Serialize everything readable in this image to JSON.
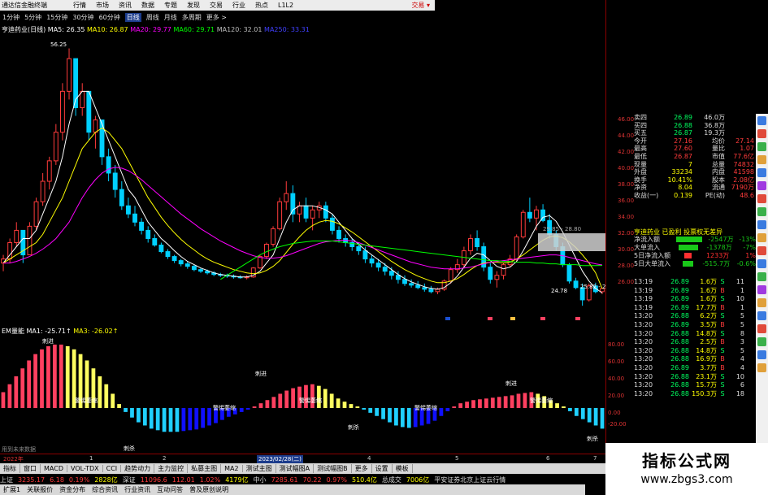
{
  "window": {
    "title": "通达信金融终端",
    "trade": "交易 ▾"
  },
  "menu": [
    "行情",
    "市场",
    "资讯",
    "数据",
    "专题",
    "发现",
    "交易",
    "行业",
    "热点",
    "L1L2"
  ],
  "timeframes": [
    "1分钟",
    "5分钟",
    "15分钟",
    "30分钟",
    "60分钟",
    "日线",
    "周线",
    "月线",
    "多周期",
    "更多 >"
  ],
  "active_tf": "日线",
  "main_legend": {
    "name": "亨迪药业(日线)",
    "ma5": "MA5: 26.35",
    "ma10": "MA10: 26.87",
    "ma20": "MA20: 29.77",
    "ma60": "MA60: 29.71",
    "ma120": "MA120: 32.01",
    "ma250": "MA250: 33.31"
  },
  "price_axis": [
    "46.00",
    "44.00",
    "42.00",
    "40.00",
    "38.00",
    "36.00",
    "34.00",
    "32.00",
    "30.00",
    "28.00",
    "26.00"
  ],
  "ind_axis": [
    "80.00",
    "60.00",
    "40.00",
    "20.00",
    "0.00",
    "-20.00"
  ],
  "price_labels": {
    "high": "56.25",
    "low": "24.78",
    "zone": "29.85 - 28.80",
    "recent": "25.82 - 26"
  },
  "ind_legend": {
    "name": "EM量能",
    "ma1": "MA1: -25.71↑",
    "ma3": "MA3: -26.02↑"
  },
  "ind_labels": {
    "strong": "刺进",
    "weak": "刺杀",
    "shrink": "警惕萎缩"
  },
  "dates": [
    "2022年",
    "1",
    "2",
    "2023/02/28(二)",
    "4",
    "5",
    "6",
    "7"
  ],
  "corner_text": "用到未来数据",
  "tabs": [
    "指标",
    "窗口",
    "MACD",
    "VOL-TDX",
    "CCI",
    "趋势动力",
    "主力监控",
    "私募主图",
    "MA2",
    "测试主图",
    "测试幅图A",
    "测试幅图B",
    "更多",
    "设置",
    "模板"
  ],
  "idx": [
    {
      "n": "上证",
      "v": "3235.17",
      "c": "6.18",
      "p": "0.19%",
      "a": "2828亿"
    },
    {
      "n": "深证",
      "v": "11096.6",
      "c": "112.01",
      "p": "1.02%",
      "a": "4179亿"
    },
    {
      "n": "中小",
      "v": "7285.61",
      "c": "70.22",
      "p": "0.97%",
      "a": "510.4亿"
    }
  ],
  "idx_extra": {
    "a": "总成交",
    "b": "7006亿",
    "c": "平安证券北京上证云行情"
  },
  "sub_status": [
    "扩展1",
    "关联报价",
    "资金分布",
    "综合资讯",
    "行业资讯",
    "互动问答",
    "普及原创说明"
  ],
  "quote_rows": [
    {
      "l": "卖四",
      "p": "26.89",
      "v": "46.0万",
      "x": ""
    },
    {
      "l": "买四",
      "p": "26.88",
      "v": "36.8万",
      "x": ""
    },
    {
      "l": "买五",
      "p": "26.87",
      "v": "19.3万",
      "x": ""
    },
    {
      "l": "今开",
      "p": "27.16",
      "v": "均价",
      "x": "27.14"
    },
    {
      "l": "最高",
      "p": "27.60",
      "v": "量比",
      "x": "1.07"
    },
    {
      "l": "最低",
      "p": "26.87",
      "v": "市值",
      "x": "77.6亿"
    },
    {
      "l": "现量",
      "p": "7",
      "v": "总量",
      "x": "74832"
    },
    {
      "l": "外盘",
      "p": "33234",
      "v": "内盘",
      "x": "41598"
    },
    {
      "l": "换手",
      "p": "10.41%",
      "v": "股本",
      "x": "2.08亿"
    },
    {
      "l": "净资",
      "p": "8.04",
      "v": "流通",
      "x": "7190万"
    },
    {
      "l": "收益(一)",
      "p": "0.139",
      "v": "PE(动)",
      "x": "48.6"
    }
  ],
  "stock_name": "亨迪药业 已盈利 投票权无差异",
  "flow": [
    {
      "l": "净流入额",
      "v": "-2547万",
      "v2": "-13%",
      "c": "#19c819",
      "w": 40
    },
    {
      "l": "大单流入",
      "v": "-1378万",
      "v2": "-7%",
      "c": "#19c819",
      "w": 28
    },
    {
      "l": "5日净流入额",
      "v": "1233万",
      "v2": "1%",
      "c": "#ff3030",
      "w": 10
    },
    {
      "l": "5日大单流入",
      "v": "-515.7万",
      "v2": "-0.6%",
      "c": "#19c819",
      "w": 14
    }
  ],
  "ticks": [
    {
      "t": "13:19",
      "p": "26.89",
      "v": "1.6万",
      "d": "S",
      "n": "11"
    },
    {
      "t": "13:19",
      "p": "26.89",
      "v": "1.6万",
      "d": "B",
      "n": "1"
    },
    {
      "t": "13:19",
      "p": "26.89",
      "v": "1.6万",
      "d": "S",
      "n": "10"
    },
    {
      "t": "13:19",
      "p": "26.89",
      "v": "17.7万",
      "d": "B",
      "n": "1"
    },
    {
      "t": "13:20",
      "p": "26.88",
      "v": "6.2万",
      "d": "S",
      "n": "5"
    },
    {
      "t": "13:20",
      "p": "26.89",
      "v": "3.5万",
      "d": "B",
      "n": "5"
    },
    {
      "t": "13:20",
      "p": "26.88",
      "v": "14.8万",
      "d": "S",
      "n": "8"
    },
    {
      "t": "13:20",
      "p": "26.88",
      "v": "2.5万",
      "d": "B",
      "n": "3"
    },
    {
      "t": "13:20",
      "p": "26.88",
      "v": "14.8万",
      "d": "S",
      "n": "5"
    },
    {
      "t": "13:20",
      "p": "26.88",
      "v": "16.9万",
      "d": "B",
      "n": "4"
    },
    {
      "t": "13:20",
      "p": "26.89",
      "v": "3.7万",
      "d": "B",
      "n": "4"
    },
    {
      "t": "13:20",
      "p": "26.88",
      "v": "23.1万",
      "d": "S",
      "n": "10"
    },
    {
      "t": "13:20",
      "p": "26.88",
      "v": "15.7万",
      "d": "S",
      "n": "6"
    },
    {
      "t": "13:20",
      "p": "26.88",
      "v": "150.3万",
      "d": "S",
      "n": "18"
    }
  ],
  "watermark": {
    "title": "指标公式网",
    "url": "www.zbgs3.com"
  },
  "colors": {
    "up": "#ff3b3b",
    "down": "#00d0ff",
    "ma5": "#ffffff",
    "ma10": "#ffff00",
    "ma20": "#ff00ff",
    "ma60": "#00ff00",
    "ma120": "#b0b0b0",
    "ma250": "#4040ff",
    "bar_red": "#ff4060",
    "bar_yel": "#ffff60",
    "bar_cyan": "#20d0ff",
    "bar_blue": "#1010ff"
  },
  "chart_data": {
    "type": "candlestick",
    "candles": [
      [
        30,
        31,
        29,
        30.5
      ],
      [
        30.5,
        33,
        30,
        32.5
      ],
      [
        32.5,
        35,
        32,
        34
      ],
      [
        34,
        33,
        30,
        31
      ],
      [
        31,
        35,
        31,
        34.5
      ],
      [
        34.5,
        38,
        34,
        37.5
      ],
      [
        37.5,
        41,
        37,
        40
      ],
      [
        40,
        43,
        39,
        42.5
      ],
      [
        42.5,
        47,
        42,
        46
      ],
      [
        46,
        52,
        45,
        51
      ],
      [
        51,
        56.25,
        50,
        55
      ],
      [
        55,
        54,
        48,
        49
      ],
      [
        49,
        52,
        48,
        51
      ],
      [
        51,
        50,
        45,
        46
      ],
      [
        46,
        48,
        44,
        47.5
      ],
      [
        47.5,
        46,
        42,
        43
      ],
      [
        43,
        44,
        40,
        41
      ],
      [
        41,
        42,
        38,
        39
      ],
      [
        39,
        40,
        36.5,
        37
      ],
      [
        37,
        38,
        35.5,
        36
      ],
      [
        36,
        37,
        34.5,
        35
      ],
      [
        35,
        35.5,
        33.5,
        34
      ],
      [
        34,
        34.5,
        32.5,
        33
      ],
      [
        33,
        33.5,
        32,
        32.2
      ],
      [
        32.2,
        32.5,
        31.2,
        31.4
      ],
      [
        31.4,
        31.7,
        30.5,
        30.8
      ],
      [
        30.8,
        31,
        30,
        30.3
      ],
      [
        30.3,
        30.5,
        29.6,
        29.9
      ],
      [
        29.9,
        30.2,
        29.3,
        29.6
      ],
      [
        29.6,
        29.8,
        29,
        29.2
      ],
      [
        29.2,
        29.4,
        28.8,
        29
      ],
      [
        29,
        29.2,
        28.6,
        28.8
      ],
      [
        28.8,
        29,
        28.4,
        28.6
      ],
      [
        28.6,
        28.8,
        28.3,
        28.5
      ],
      [
        28.5,
        28.7,
        28.2,
        28.4
      ],
      [
        28.4,
        28.6,
        28.1,
        28.3
      ],
      [
        28.3,
        28.5,
        28.1,
        28.2
      ],
      [
        28.2,
        28.5,
        28,
        28.3
      ],
      [
        28.3,
        29.5,
        28.2,
        29.4
      ],
      [
        29.4,
        31,
        29.3,
        30.8
      ],
      [
        30.8,
        32.5,
        30.5,
        32.3
      ],
      [
        32.3,
        34.5,
        32,
        34.2
      ],
      [
        34.2,
        38,
        34,
        37.5
      ],
      [
        37.5,
        40,
        36.5,
        38.5
      ],
      [
        38.5,
        39.5,
        35,
        36
      ],
      [
        36,
        37.5,
        35,
        37
      ],
      [
        37,
        38,
        35,
        35.5
      ],
      [
        35.5,
        37,
        34,
        36.5
      ],
      [
        36.5,
        37.5,
        35.5,
        37
      ],
      [
        37,
        37.5,
        35,
        35.5
      ],
      [
        35.5,
        36,
        33.5,
        34
      ],
      [
        34,
        34.5,
        32.5,
        33
      ],
      [
        33,
        33.5,
        32,
        32.5
      ],
      [
        32.5,
        33,
        31.5,
        32
      ],
      [
        32,
        32.5,
        31,
        31.5
      ],
      [
        31.5,
        32,
        30,
        30.5
      ],
      [
        30.5,
        31,
        29.5,
        30
      ],
      [
        30,
        30.5,
        29,
        29.5
      ],
      [
        29.5,
        30,
        28.5,
        29
      ],
      [
        29,
        29.5,
        28,
        28.5
      ],
      [
        28.5,
        29,
        27.5,
        28
      ],
      [
        28,
        28.5,
        27.2,
        27.5
      ],
      [
        27.5,
        28,
        27,
        27.3
      ],
      [
        27.3,
        27.8,
        26.8,
        27
      ],
      [
        27,
        27.5,
        26.5,
        26.8
      ],
      [
        26.8,
        27.2,
        26.3,
        26.5
      ],
      [
        26.5,
        27,
        26.2,
        26.8
      ],
      [
        26.8,
        28,
        26.6,
        27.8
      ],
      [
        27.8,
        29.5,
        27.5,
        29.2
      ],
      [
        29.2,
        30.5,
        28.8,
        29.8
      ],
      [
        29.8,
        32,
        29.5,
        31.5
      ],
      [
        31.5,
        33.5,
        31,
        33
      ],
      [
        33,
        34,
        31.5,
        32
      ],
      [
        32,
        32.5,
        29,
        29.5
      ],
      [
        29.5,
        30,
        27.5,
        28
      ],
      [
        28,
        29,
        27,
        28.5
      ],
      [
        28.5,
        30,
        28,
        29.8
      ],
      [
        29.8,
        31,
        29.5,
        30.5
      ],
      [
        30.5,
        33.5,
        30.2,
        33.2
      ],
      [
        33.2,
        36.5,
        33,
        36.2
      ],
      [
        36.2,
        38,
        35,
        35.5
      ],
      [
        35.5,
        37,
        34,
        36.5
      ],
      [
        36.5,
        37.2,
        35,
        35.2
      ],
      [
        35.2,
        36,
        33,
        33.5
      ],
      [
        33.5,
        34,
        31.5,
        32
      ],
      [
        32,
        32.5,
        29.5,
        29.8
      ],
      [
        29.8,
        30,
        27.5,
        27.8
      ],
      [
        27.8,
        28.2,
        26.8,
        27
      ],
      [
        27,
        27.5,
        24.78,
        25.5
      ],
      [
        25.5,
        27.5,
        25.3,
        27.2
      ],
      [
        27.2,
        27.6,
        26.3,
        26.5
      ],
      [
        26.5,
        27,
        26.2,
        26.89
      ]
    ],
    "ma5": [
      30,
      31,
      32,
      33,
      33,
      34,
      36,
      38,
      40,
      43,
      47,
      50,
      51,
      51,
      49,
      47,
      45,
      43,
      41,
      39,
      38,
      36.5,
      35,
      34,
      33,
      32.3,
      31.5,
      30.8,
      30.2,
      29.8,
      29.4,
      29.1,
      28.8,
      28.6,
      28.5,
      28.4,
      28.3,
      28.3,
      28.5,
      29,
      30,
      31,
      33,
      35,
      36.5,
      37,
      37,
      37,
      36.8,
      36.5,
      36,
      35,
      34,
      33,
      32.3,
      31.6,
      31,
      30.4,
      29.8,
      29.2,
      28.6,
      28.1,
      27.7,
      27.4,
      27.1,
      26.9,
      26.8,
      27,
      27.6,
      28.4,
      29.5,
      30.6,
      31.2,
      31,
      30.3,
      29.6,
      29.3,
      29.5,
      30.2,
      31.5,
      33,
      34.5,
      35.6,
      35.8,
      35.1,
      33.8,
      32.2,
      30.6,
      29,
      27.8,
      26.9,
      26.35
    ],
    "ma10": [
      30,
      30.5,
      31,
      31.5,
      32,
      32.5,
      33.5,
      35,
      36.5,
      38,
      40,
      42,
      44,
      45,
      46,
      46.5,
      46,
      45,
      44,
      42.5,
      41,
      39.5,
      38,
      36.8,
      35.6,
      34.6,
      33.7,
      32.9,
      32.2,
      31.6,
      31,
      30.5,
      30.1,
      29.8,
      29.5,
      29.2,
      29,
      28.8,
      28.7,
      28.8,
      29.1,
      29.6,
      30.3,
      31.3,
      32.3,
      33.2,
      34,
      34.6,
      35,
      35.2,
      35.1,
      34.8,
      34.3,
      33.8,
      33.2,
      32.6,
      32,
      31.4,
      30.8,
      30.2,
      29.7,
      29.2,
      28.8,
      28.4,
      28.1,
      27.8,
      27.6,
      27.6,
      27.8,
      28.1,
      28.6,
      29.2,
      29.7,
      30,
      30.1,
      30.1,
      30,
      30.1,
      30.5,
      31,
      31.6,
      32.2,
      32.8,
      33.2,
      33.3,
      33.1,
      32.6,
      31.9,
      31,
      30,
      28.8,
      26.87
    ],
    "ma20": [
      30,
      30,
      30.2,
      30.5,
      30.8,
      31.2,
      31.7,
      32.3,
      33,
      34,
      35,
      36.5,
      38,
      39.2,
      40.2,
      41,
      41.5,
      41.7,
      41.6,
      41.3,
      40.8,
      40.2,
      39.5,
      38.8,
      38.1,
      37.4,
      36.7,
      36,
      35.4,
      34.8,
      34.2,
      33.7,
      33.2,
      32.7,
      32.3,
      31.9,
      31.5,
      31.2,
      30.9,
      30.7,
      30.6,
      30.6,
      30.7,
      30.9,
      31.2,
      31.5,
      31.8,
      32.1,
      32.4,
      32.6,
      32.7,
      32.8,
      32.8,
      32.7,
      32.5,
      32.2,
      31.9,
      31.6,
      31.3,
      31,
      30.7,
      30.4,
      30.1,
      29.9,
      29.7,
      29.5,
      29.4,
      29.3,
      29.3,
      29.3,
      29.4,
      29.5,
      29.7,
      29.9,
      30.1,
      30.2,
      30.3,
      30.4,
      30.5,
      30.6,
      30.7,
      30.8,
      30.9,
      31,
      31,
      30.9,
      30.7,
      30.5,
      30.3,
      30.1,
      29.9,
      29.77
    ],
    "ma60": [
      null,
      null,
      null,
      null,
      null,
      null,
      null,
      null,
      null,
      null,
      null,
      null,
      null,
      null,
      null,
      null,
      null,
      null,
      null,
      null,
      null,
      null,
      null,
      null,
      null,
      null,
      null,
      null,
      null,
      null,
      null,
      null,
      null,
      28,
      28.5,
      29,
      29.5,
      30,
      30.5,
      31,
      31.4,
      31.7,
      32,
      32.2,
      32.4,
      32.5,
      32.6,
      32.7,
      32.7,
      32.7,
      32.7,
      32.6,
      32.5,
      32.4,
      32.3,
      32.2,
      32.1,
      32,
      31.9,
      31.8,
      31.7,
      31.6,
      31.5,
      31.4,
      31.3,
      31.2,
      31.1,
      31,
      30.9,
      30.8,
      30.7,
      30.6,
      30.5,
      30.4,
      30.3,
      30.3,
      30.2,
      30.2,
      30.1,
      30.1,
      30.1,
      30,
      30,
      29.9,
      29.9,
      29.8,
      29.8,
      29.8,
      29.7,
      29.7,
      29.7,
      29.71
    ],
    "ma120": [
      null,
      null,
      null,
      null,
      null,
      null,
      null,
      null,
      null,
      null,
      null,
      null,
      null,
      null,
      null,
      null,
      null,
      null,
      null,
      null,
      null,
      null,
      null,
      null,
      null,
      null,
      null,
      null,
      null,
      null,
      null,
      null,
      null,
      null,
      null,
      null,
      null,
      null,
      null,
      null,
      null,
      null,
      null,
      null,
      null,
      null,
      null,
      null,
      null,
      null,
      null,
      null,
      null,
      null,
      null,
      null,
      null,
      null,
      null,
      null,
      null,
      null,
      null,
      null,
      null,
      null,
      null,
      null,
      null,
      null,
      null,
      null,
      null,
      null,
      null,
      null,
      null,
      null,
      null,
      null,
      null,
      null,
      null,
      null,
      null,
      null,
      null,
      null,
      null,
      null,
      null,
      32.01
    ],
    "ind": [
      20,
      30,
      40,
      50,
      60,
      68,
      74,
      78,
      80,
      80,
      78,
      74,
      68,
      60,
      50,
      40,
      30,
      18,
      5,
      -5,
      -12,
      -18,
      -22,
      -26,
      -28,
      -30,
      -30,
      -30,
      -29,
      -28,
      -27,
      -25,
      -22,
      -19,
      -15,
      -11,
      -8,
      -5,
      -2,
      2,
      6,
      10,
      14,
      18,
      22,
      25,
      27,
      29,
      30,
      28,
      24,
      18,
      12,
      8,
      5,
      2,
      -2,
      -6,
      -10,
      -14,
      -18,
      -22,
      -24,
      -25,
      -24,
      -22,
      -20,
      -16,
      -10,
      -4,
      2,
      6,
      8,
      10,
      11,
      12,
      13,
      14,
      15,
      16,
      18,
      19,
      20,
      18,
      15,
      10,
      6,
      2,
      -4,
      -10,
      -14,
      -18,
      -22,
      -26
    ]
  }
}
